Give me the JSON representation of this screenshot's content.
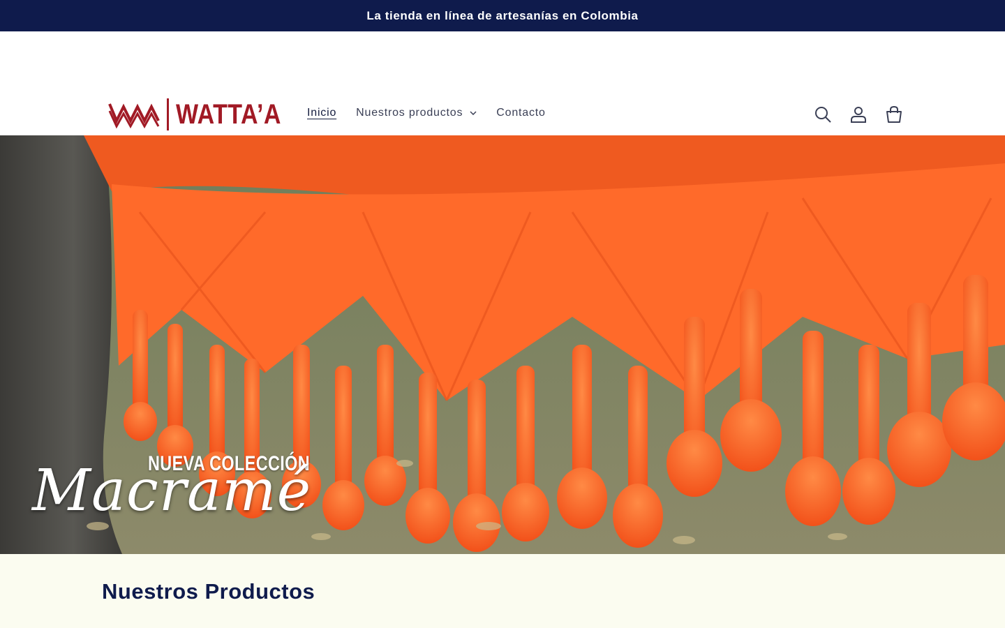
{
  "announcement": {
    "text": "La tienda en línea de artesanías en Colombia"
  },
  "brand": {
    "name": "WATTA’A",
    "logo_icon": "woven-zigzag-logo-icon",
    "color": "#a11a25"
  },
  "nav": {
    "items": [
      {
        "label": "Inicio",
        "active": true
      },
      {
        "label": "Nuestros productos",
        "has_dropdown": true
      },
      {
        "label": "Contacto"
      }
    ]
  },
  "header_icons": {
    "search": "search-icon",
    "account": "account-icon",
    "cart": "cart-icon"
  },
  "hero": {
    "subtitle": "NUEVA COLECCIÓN",
    "title": "Macramé",
    "accent_color": "#ff5a1f"
  },
  "section": {
    "title": "Nuestros Productos"
  },
  "colors": {
    "announcement_bg": "#0f1b4c",
    "section_bg": "#fbfcf0",
    "heading": "#0f1b4c"
  }
}
